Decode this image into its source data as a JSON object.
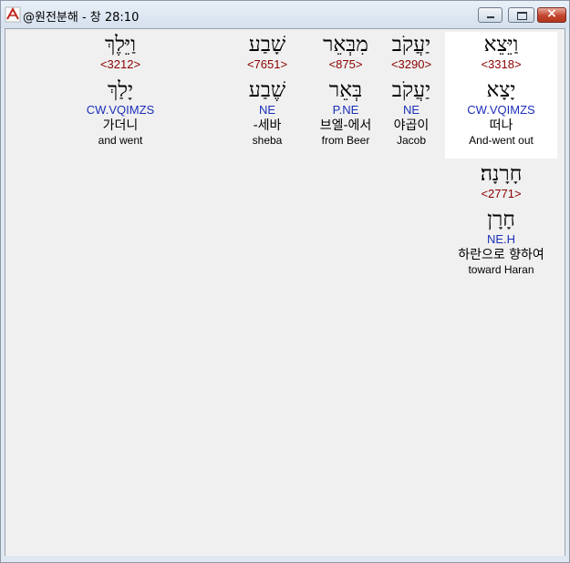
{
  "window": {
    "title": "@원전분해 - 창 28:10"
  },
  "words": [
    {
      "surface": "וַיֵּצֵא",
      "strong": "<3318>",
      "root": "יָצָא",
      "parse": "CW.VQIMZS",
      "korean": "떠나",
      "english": "And-went out",
      "selected": true
    },
    {
      "surface": "יַעֲקֹב",
      "strong": "<3290>",
      "root": "יַעֲקֹב",
      "parse": "NE",
      "korean": "야곱이",
      "english": "Jacob"
    },
    {
      "surface": "מִבְּאֵר",
      "strong": "<875>",
      "root": "בְּאֵר",
      "parse": "P.NE",
      "korean": "브엘-에서",
      "english": "from Beer"
    },
    {
      "surface": "שָׁבַע",
      "strong": "<7651>",
      "root": "שֶׁבַע",
      "parse": "NE",
      "korean": "-세바",
      "english": "sheba"
    },
    {
      "surface": "וַיֵּלֶךְ",
      "strong": "<3212>",
      "root": "יָלַךְ",
      "parse": "CW.VQIMZS",
      "korean": "가더니",
      "english": "and went"
    },
    {
      "surface": "חָרָנָה׃",
      "strong": "<2771>",
      "root": "חָרָן",
      "parse": "NE.H",
      "korean": "하란으로 향하여",
      "english": "toward Haran"
    }
  ]
}
